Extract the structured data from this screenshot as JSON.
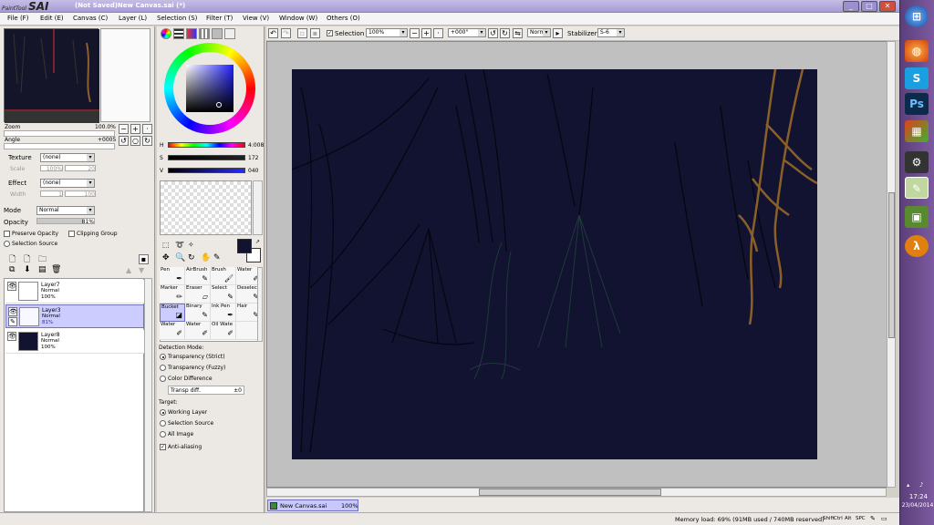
{
  "app": {
    "logo_small": "PaintTool",
    "logo": "SAI",
    "window_title": "(Not Saved)New Canvas.sai (*)"
  },
  "menu": [
    "File (F)",
    "Edit (E)",
    "Canvas (C)",
    "Layer (L)",
    "Selection (S)",
    "Filter (T)",
    "View (V)",
    "Window (W)",
    "Others (O)"
  ],
  "navigator": {
    "zoom_label": "Zoom",
    "zoom_value": "100.0%",
    "angle_label": "Angle",
    "angle_value": "+0005"
  },
  "brush_panel": {
    "texture_label": "Texture",
    "texture_value": "(none)",
    "scale_label": "Scale",
    "scale_value": "100%",
    "scale_num": "20",
    "effect_label": "Effect",
    "effect_value": "(none)",
    "width_label": "Width",
    "width_value": "1",
    "width_num": "100",
    "mode_label": "Mode",
    "mode_value": "Normal",
    "opacity_label": "Opacity",
    "opacity_value": "81%",
    "preserve_opacity": "Preserve Opacity",
    "clipping_group": "Clipping Group",
    "selection_source": "Selection Source"
  },
  "layers": [
    {
      "name": "Layer7",
      "mode": "Normal",
      "opacity": "100%",
      "selected": false
    },
    {
      "name": "Layer3",
      "mode": "Normal",
      "opacity": "81%",
      "selected": true
    },
    {
      "name": "Layer8",
      "mode": "Normal",
      "opacity": "100%",
      "selected": false
    }
  ],
  "color": {
    "h_label": "H",
    "h_value": "4:008",
    "s_label": "S",
    "s_value": "172",
    "v_label": "V",
    "v_value": "040",
    "primary": "#121330",
    "secondary": "#ffffff"
  },
  "tools": [
    {
      "label": "Pen",
      "icon": "pen-icon"
    },
    {
      "label": "AirBrush",
      "icon": "airbrush-icon"
    },
    {
      "label": "Brush",
      "icon": "brush-icon"
    },
    {
      "label": "Water",
      "icon": "water-icon"
    },
    {
      "label": "Marker",
      "icon": "marker-icon"
    },
    {
      "label": "Eraser",
      "icon": "eraser-icon"
    },
    {
      "label": "Select",
      "icon": "select-icon"
    },
    {
      "label": "Deselect",
      "icon": "deselect-icon"
    },
    {
      "label": "Bucket",
      "icon": "bucket-icon"
    },
    {
      "label": "Binary",
      "icon": "binary-icon"
    },
    {
      "label": "Ink Pen",
      "icon": "ink-pen-icon"
    },
    {
      "label": "Hair",
      "icon": "hair-icon"
    },
    {
      "label": "Water",
      "icon": "water-icon"
    },
    {
      "label": "Water",
      "icon": "water-icon"
    },
    {
      "label": "Oil Wate",
      "icon": "oil-water-icon"
    },
    {
      "label": "",
      "icon": ""
    }
  ],
  "tool_options": {
    "detection_mode_label": "Detection Mode:",
    "transparency_strict": "Transparency (Strict)",
    "transparency_fuzzy": "Transparency (Fuzzy)",
    "color_difference": "Color Difference",
    "transp_diff_label": "Transp diff.",
    "transp_diff_value": "±0",
    "target_label": "Target:",
    "working_layer": "Working Layer",
    "selection_source": "Selection Source",
    "all_image": "All Image",
    "anti_aliasing": "Anti-aliasing"
  },
  "canvas_toolbar": {
    "selection_label": "Selection",
    "zoom": "100%",
    "angle": "+000°",
    "mode": "Normal",
    "stabilizer_label": "Stabilizer",
    "stabilizer_value": "S-6"
  },
  "canvas": {
    "background": "#121330"
  },
  "doc_tab": {
    "name": "New Canvas.sai",
    "zoom": "100%"
  },
  "status": {
    "memory": "Memory load: 69% (91MB used / 740MB reserved)",
    "keys": [
      "Shift",
      "Ctrl",
      "Alt",
      "SPC"
    ]
  },
  "taskbar": {
    "time": "17:24",
    "date": "23/04/2014"
  }
}
